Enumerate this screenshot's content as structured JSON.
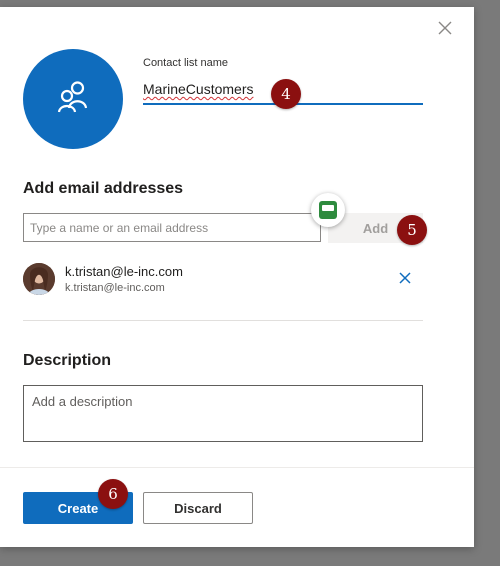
{
  "dialog": {
    "contact_list_label": "Contact list name",
    "contact_list_name": "MarineCustomers",
    "add_email_title": "Add email addresses",
    "email_placeholder": "Type a name or an email address",
    "add_label": "Add",
    "member": {
      "name": "k.tristan@le-inc.com",
      "email": "k.tristan@le-inc.com"
    },
    "description_title": "Description",
    "description_placeholder": "Add a description",
    "create_label": "Create",
    "discard_label": "Discard"
  },
  "annotations": [
    "4",
    "5",
    "6"
  ],
  "colors": {
    "accent": "#0f6cbd",
    "badge": "#8b1010",
    "extension": "#2e8b3e"
  },
  "icons": [
    "close-icon",
    "people-icon",
    "extension-icon",
    "remove-icon"
  ]
}
